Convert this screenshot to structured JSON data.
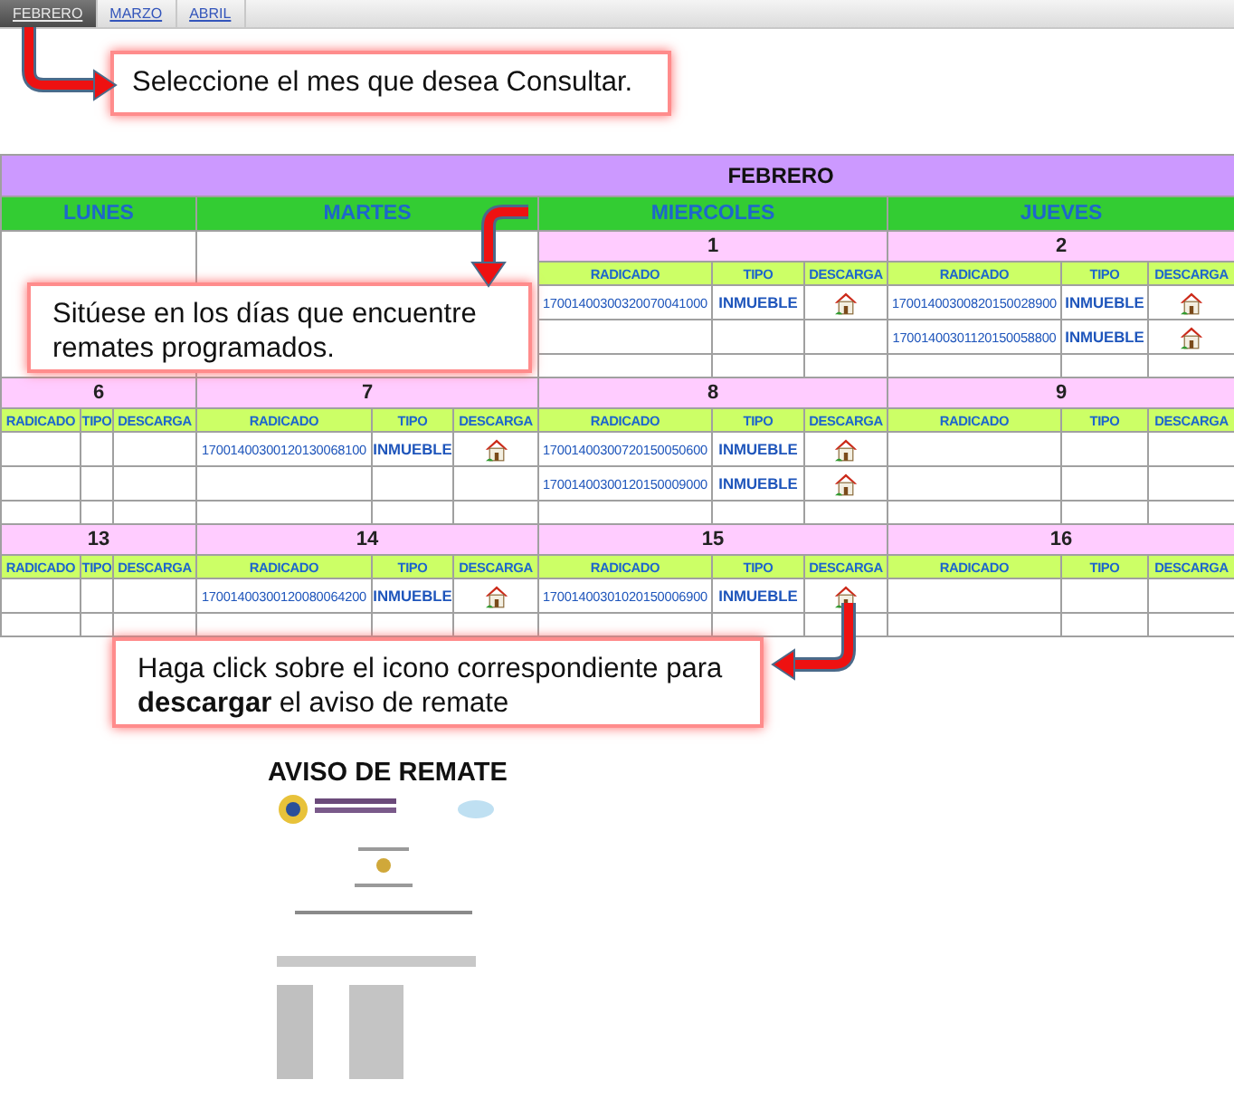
{
  "month_tabs": [
    {
      "label": "FEBRERO",
      "selected": true
    },
    {
      "label": "MARZO",
      "selected": false
    },
    {
      "label": "ABRIL",
      "selected": false
    }
  ],
  "callouts": [
    "Seleccione el mes que desea Consultar.",
    "Sitúese en los días que encuentre remates programados.",
    "Haga click sobre el icono correspondiente para **descargar** el aviso de remate"
  ],
  "calendar": {
    "month": "FEBRERO",
    "weekdays": [
      "LUNES",
      "MARTES",
      "MIERCOLES",
      "JUEVES"
    ],
    "weeks": [
      {
        "days": [
          {
            "kind": "empty"
          },
          {
            "kind": "empty"
          },
          {
            "kind": "day",
            "number": "1",
            "columns": [
              "RADICADO",
              "TIPO",
              "DESCARGA"
            ],
            "entries": [
              {
                "radicado": "17001400300320070041000",
                "tipo": "INMUEBLE"
              }
            ]
          },
          {
            "kind": "day",
            "number": "2",
            "columns": [
              "RADICADO",
              "TIPO",
              "DESCARGA"
            ],
            "entries": [
              {
                "radicado": "17001400300820150028900",
                "tipo": "INMUEBLE"
              },
              {
                "radicado": "17001400301120150058800",
                "tipo": "INMUEBLE"
              }
            ]
          }
        ]
      },
      {
        "days": [
          {
            "kind": "day",
            "number": "6",
            "columns": [
              "RADICADO",
              "TIPO",
              "DESCARGA"
            ]
          },
          {
            "kind": "day",
            "number": "7",
            "columns": [
              "RADICADO",
              "TIPO",
              "DESCARGA"
            ],
            "entries": [
              {
                "radicado": "17001400300120130068100",
                "tipo": "INMUEBLE"
              }
            ]
          },
          {
            "kind": "day",
            "number": "8",
            "columns": [
              "RADICADO",
              "TIPO",
              "DESCARGA"
            ],
            "entries": [
              {
                "radicado": "17001400300720150050600",
                "tipo": "INMUEBLE"
              },
              {
                "radicado": "17001400300120150009000",
                "tipo": "INMUEBLE"
              }
            ]
          },
          {
            "kind": "day",
            "number": "9",
            "columns": [
              "RADICADO",
              "TIPO",
              "DESCARGA"
            ]
          }
        ]
      },
      {
        "days": [
          {
            "kind": "day",
            "number": "13",
            "columns": [
              "RADICADO",
              "TIPO",
              "DESCARGA"
            ]
          },
          {
            "kind": "day",
            "number": "14",
            "columns": [
              "RADICADO",
              "TIPO",
              "DESCARGA"
            ],
            "entries": [
              {
                "radicado": "17001400300120080064200",
                "tipo": "INMUEBLE"
              }
            ]
          },
          {
            "kind": "day",
            "number": "15",
            "columns": [
              "RADICADO",
              "TIPO",
              "DESCARGA"
            ],
            "entries": [
              {
                "radicado": "17001400301020150006900",
                "tipo": "INMUEBLE"
              }
            ]
          },
          {
            "kind": "day",
            "number": "16",
            "columns": [
              "RADICADO",
              "TIPO",
              "DESCARGA"
            ]
          }
        ]
      }
    ]
  },
  "document": {
    "title": "AVISO DE REMATE",
    "kind": "picture"
  }
}
